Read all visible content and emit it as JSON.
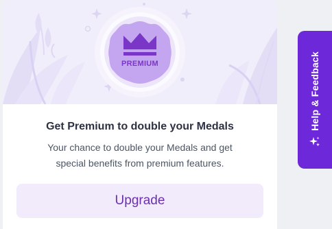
{
  "card": {
    "badge_text": "PREMIUM",
    "title": "Get Premium to double your Medals",
    "description_line1": "Your chance to double your Medals and get",
    "description_line2": "special benefits from premium features.",
    "upgrade_label": "Upgrade"
  },
  "help_tab": {
    "label": "Help & Feedback",
    "icon": "sparkle-icon"
  },
  "colors": {
    "accent": "#6d28d9",
    "badge": "#c4a5f0",
    "button_bg": "#f1ebfc",
    "button_text": "#6b2fb0"
  }
}
